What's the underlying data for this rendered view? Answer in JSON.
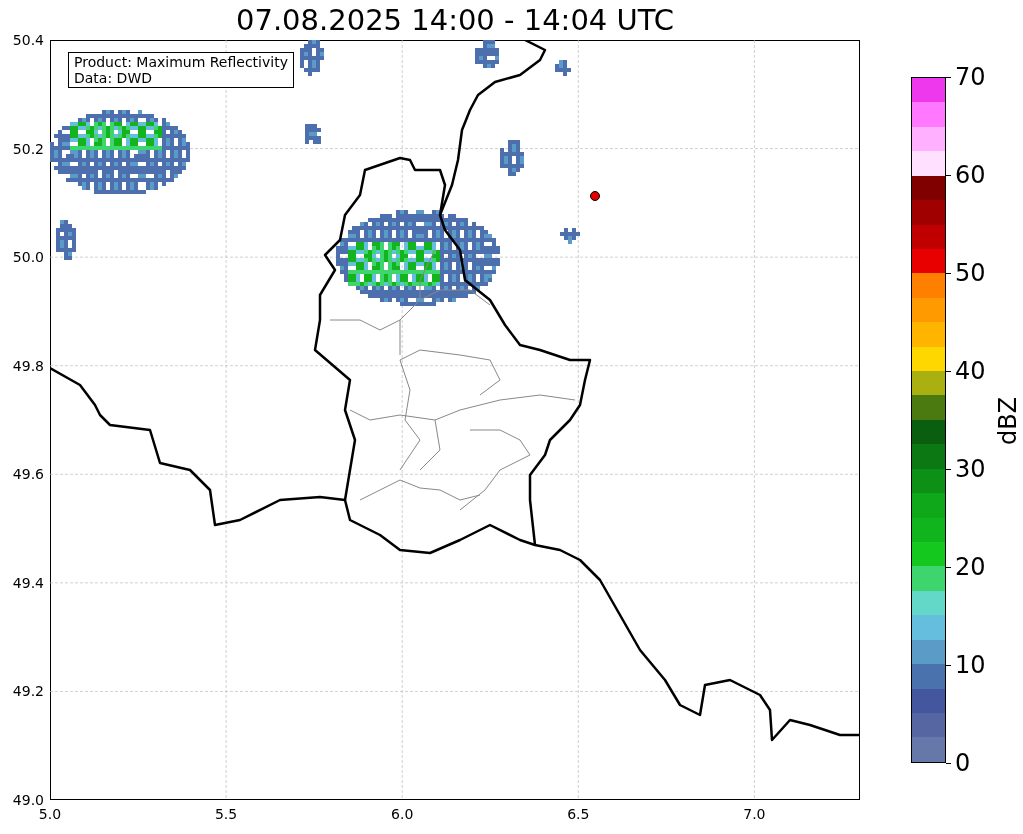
{
  "title": "07.08.2025 14:00 - 14:04 UTC",
  "map": {
    "info_lines": [
      "Product: Maximum Reflectivity",
      "Data: DWD"
    ],
    "xticks": [
      "5.0",
      "5.5",
      "6.0",
      "6.5",
      "7.0"
    ],
    "yticks": [
      "50.4",
      "50.2",
      "50.0",
      "49.8",
      "49.6",
      "49.4",
      "49.2",
      "49.0"
    ]
  },
  "colorbar": {
    "label": "dBZ",
    "ticks": [
      "70",
      "60",
      "50",
      "40",
      "30",
      "20",
      "10",
      "0"
    ],
    "segments": [
      {
        "color": "#ee38ee"
      },
      {
        "color": "#ff78ff"
      },
      {
        "color": "#ffb0ff"
      },
      {
        "color": "#ffe0ff"
      },
      {
        "color": "#800000"
      },
      {
        "color": "#a00000"
      },
      {
        "color": "#c00000"
      },
      {
        "color": "#e80000"
      },
      {
        "color": "#ff7f00"
      },
      {
        "color": "#ff9a00"
      },
      {
        "color": "#ffb400"
      },
      {
        "color": "#ffd700"
      },
      {
        "color": "#aab010"
      },
      {
        "color": "#4a7a10"
      },
      {
        "color": "#0a5e10"
      },
      {
        "color": "#0b7814"
      },
      {
        "color": "#0c9016"
      },
      {
        "color": "#0ea81a"
      },
      {
        "color": "#10b41c"
      },
      {
        "color": "#14c81e"
      },
      {
        "color": "#3ed46e"
      },
      {
        "color": "#64d8c8"
      },
      {
        "color": "#66bedf"
      },
      {
        "color": "#5a9bc8"
      },
      {
        "color": "#4a72ac"
      },
      {
        "color": "#44579e"
      },
      {
        "color": "#5566a2"
      },
      {
        "color": "#6677aa"
      }
    ]
  }
}
